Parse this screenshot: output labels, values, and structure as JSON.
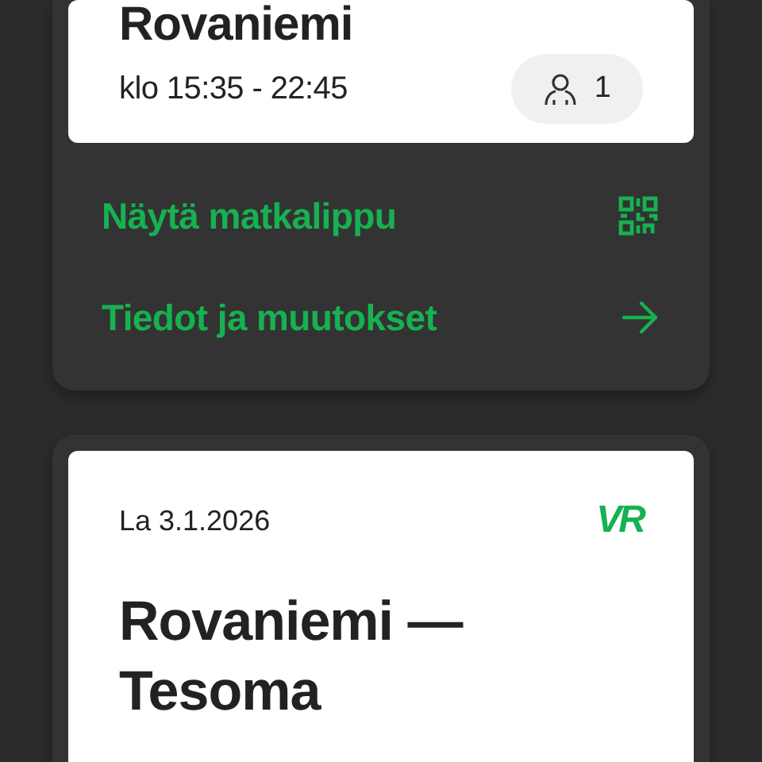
{
  "trips": [
    {
      "title": "Rovaniemi",
      "time": "klo 15:35 - 22:45",
      "passengers": "1",
      "actions": [
        {
          "kind": "qr",
          "label": "Näytä matkalippu"
        },
        {
          "kind": "arrow",
          "label": "Tiedot ja muutokset"
        }
      ]
    },
    {
      "date": "La 3.1.2026",
      "logo": "VR",
      "title": "Rovaniemi — Tesoma"
    }
  ]
}
